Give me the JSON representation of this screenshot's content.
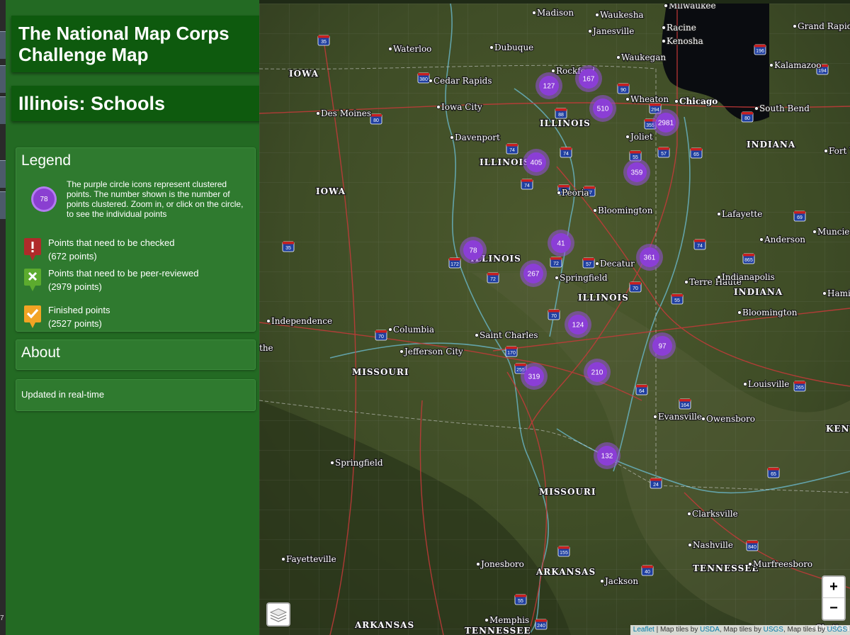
{
  "colors": {
    "sidebar": "#236a23",
    "banner": "#0e5a0e",
    "cluster": "#8b3ed6",
    "check_marker": "#b02a2a",
    "peer_marker": "#5cab2e",
    "finished_marker": "#f2a424"
  },
  "desktop_strip": {
    "label": "7"
  },
  "header": {
    "title_line1": "The National Map Corps",
    "title_line2": "Challenge Map",
    "subtitle": "Illinois: Schools"
  },
  "legend": {
    "title": "Legend",
    "cluster_example": "78",
    "cluster_desc": "The purple circle icons represent clustered points. The number shown is the number of points clustered. Zoom in, or click on the circle, to see the individual points",
    "items": [
      {
        "icon": "exclamation-marker-icon",
        "label": "Points that need to be checked",
        "count": "(672 points)"
      },
      {
        "icon": "x-marker-icon",
        "label": "Points that need to be peer-reviewed",
        "count": "(2979 points)"
      },
      {
        "icon": "check-marker-icon",
        "label": "Finished points",
        "count": "(2527 points)"
      }
    ]
  },
  "about": {
    "title": "About"
  },
  "updated": {
    "text": "Updated in real-time"
  },
  "map": {
    "clusters": [
      "127",
      "167",
      "510",
      "2981",
      "405",
      "359",
      "78",
      "41",
      "361",
      "267",
      "124",
      "97",
      "319",
      "210",
      "132"
    ],
    "places": [
      "Madison",
      "Waukesha",
      "Milwaukee",
      "Janesville",
      "Racine",
      "Kenosha",
      "Grand Rapids",
      "Waterloo",
      "Dubuque",
      "Waukegan",
      "Kalamazoo",
      "IOWA",
      "Cedar Rapids",
      "Rockford",
      "Wheaton",
      "Chicago",
      "Des Moines",
      "Iowa City",
      "ILLINOIS",
      "South Bend",
      "Davenport",
      "Joliet",
      "INDIANA",
      "Fort Wayne",
      "ILLINOIS",
      "IOWA",
      "Peoria",
      "Bloomington",
      "Lafayette",
      "Muncie",
      "Anderson",
      "ILLINOIS",
      "Decatur",
      "Springfield",
      "Terre Haute",
      "Indianapolis",
      "INDIANA",
      "Hamilton",
      "ILLINOIS",
      "Bloomington",
      "Independence",
      "Columbia",
      "Saint Charles",
      "Jefferson City",
      "MISSOURI",
      "the",
      "Louisville",
      "Evansville",
      "Owensboro",
      "KENTUCKY",
      "Springfield",
      "MISSOURI",
      "Clarksville",
      "Nashville",
      "Fayetteville",
      "Jonesboro",
      "ARKANSAS",
      "TENNESSEE",
      "Murfreesboro",
      "Jackson",
      "Memphis",
      "ARKANSAS",
      "TENNESSEE",
      "Chattanooga"
    ],
    "zoom_in": "+",
    "zoom_out": "−",
    "attribution": {
      "leaflet": "Leaflet",
      "sep1": " | Map tiles by ",
      "usda": "USDA",
      "sep2": ", Map tiles by ",
      "usgs1": "USGS",
      "sep3": ", Map tiles by ",
      "usgs2": "USGS"
    }
  }
}
